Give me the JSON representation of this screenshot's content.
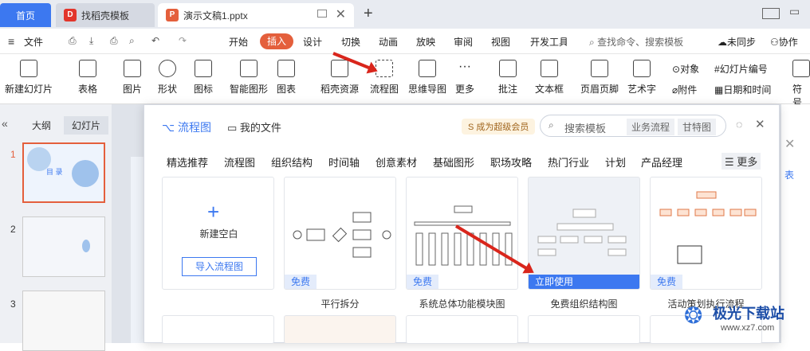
{
  "tabs": {
    "home": "首页",
    "daoke": "找稻壳模板",
    "doc": "演示文稿1.pptx"
  },
  "menu": {
    "file": "文件",
    "items": [
      "开始",
      "插入",
      "设计",
      "切换",
      "动画",
      "放映",
      "审阅",
      "视图",
      "开发工具"
    ],
    "search": "查找命令、搜索模板",
    "unsync": "未同步",
    "collab": "协作"
  },
  "ribbon": {
    "new_slide": "新建幻灯片",
    "table": "表格",
    "picture": "图片",
    "shape": "形状",
    "icon": "图标",
    "smart": "智能图形",
    "chart": "图表",
    "daoke_res": "稻壳资源",
    "flowchart": "流程图",
    "mindmap": "思维导图",
    "more": "更多",
    "comment": "批注",
    "textbox": "文本框",
    "header": "页眉页脚",
    "wordart": "艺术字",
    "object": "对象",
    "attach": "附件",
    "slide_no": "幻灯片编号",
    "datetime": "日期和时间",
    "symbol": "符号"
  },
  "left": {
    "outline": "大纲",
    "slides": "幻灯片",
    "nums": [
      "1",
      "2",
      "3"
    ],
    "thumb1_title": "目 录"
  },
  "modal": {
    "title": "流程图",
    "myfiles": "我的文件",
    "vip": "成为超级会员",
    "search_placeholder": "搜索模板",
    "tag1": "业务流程",
    "tag2": "甘特图",
    "more": "更多",
    "categories": [
      "精选推荐",
      "流程图",
      "组织结构",
      "时间轴",
      "创意素材",
      "基础图形",
      "职场攻略",
      "热门行业",
      "计划",
      "产品经理"
    ],
    "new_blank": "新建空白",
    "import": "导入流程图",
    "cards": [
      {
        "badge": "免费",
        "caption": "平行拆分"
      },
      {
        "badge": "免费",
        "caption": "系统总体功能模块图"
      },
      {
        "badge": "立即使用",
        "caption": "免费组织结构图"
      },
      {
        "badge": "免费",
        "caption": "活动策划执行流程"
      }
    ]
  },
  "watermark": {
    "name": "极光下载站",
    "url": "www.xz7.com"
  },
  "side_snip": {
    "a": "表",
    "b": "表"
  }
}
